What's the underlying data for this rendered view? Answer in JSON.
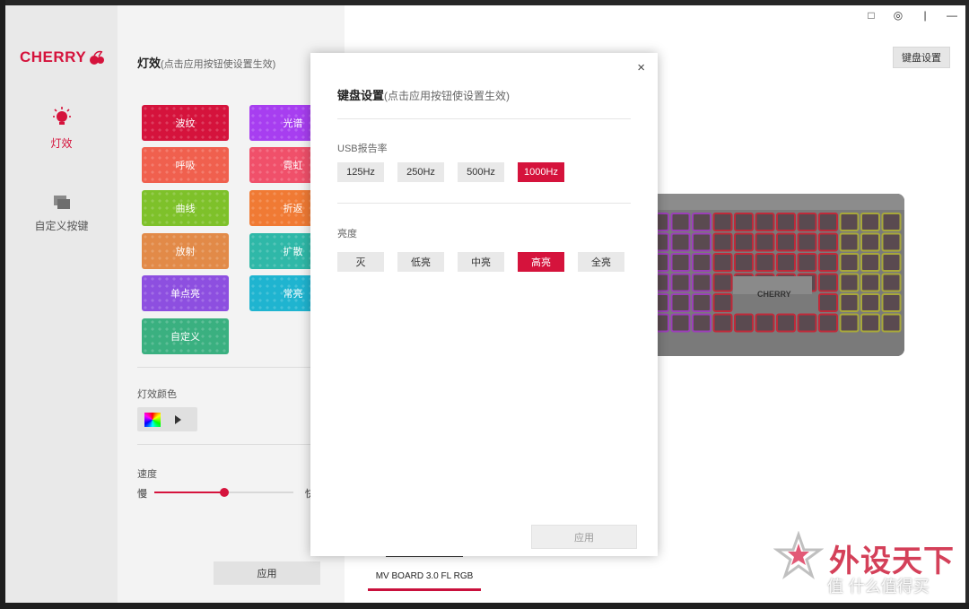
{
  "sidebar": {
    "logo_text": "CHERRY",
    "items": [
      {
        "label": "灯效",
        "icon": "bulb-icon",
        "active": true
      },
      {
        "label": "自定义按键",
        "icon": "keys-icon",
        "active": false
      }
    ]
  },
  "panel": {
    "title": "灯效",
    "title_hint": "(点击应用按钮使设置生效)",
    "effects": [
      {
        "label": "波纹",
        "color": "#d5133c"
      },
      {
        "label": "光谱",
        "color": "#a73ef0"
      },
      {
        "label": "呼吸",
        "color": "#f0604e"
      },
      {
        "label": "霓虹",
        "color": "#f0506a"
      },
      {
        "label": "曲线",
        "color": "#7ec12a"
      },
      {
        "label": "折返",
        "color": "#f07a34"
      },
      {
        "label": "放射",
        "color": "#e28a48"
      },
      {
        "label": "扩散",
        "color": "#2fb8a8"
      },
      {
        "label": "单点亮",
        "color": "#8d4fe0"
      },
      {
        "label": "常亮",
        "color": "#1fb4d0"
      },
      {
        "label": "自定义",
        "color": "#3ab080"
      }
    ],
    "color_label": "灯效颜色",
    "speed_label": "速度",
    "speed_slow": "慢",
    "speed_fast": "快",
    "speed_value": 0.5,
    "apply_label": "应用"
  },
  "main": {
    "keyboard_settings_button": "键盘设置",
    "device_name": "MV BOARD 3.0 FL RGB",
    "keyboard_brand": "CHERRY"
  },
  "window_controls": [
    "□",
    "◎",
    "|",
    "—"
  ],
  "modal": {
    "title": "键盘设置",
    "title_hint": "(点击应用按钮使设置生效)",
    "close_label": "×",
    "usb_label": "USB报告率",
    "usb_options": [
      {
        "label": "125Hz",
        "active": false
      },
      {
        "label": "250Hz",
        "active": false
      },
      {
        "label": "500Hz",
        "active": false
      },
      {
        "label": "1000Hz",
        "active": true
      }
    ],
    "brightness_label": "亮度",
    "brightness_options": [
      {
        "label": "灭",
        "active": false
      },
      {
        "label": "低亮",
        "active": false
      },
      {
        "label": "中亮",
        "active": false
      },
      {
        "label": "高亮",
        "active": true
      },
      {
        "label": "全亮",
        "active": false
      }
    ],
    "apply_label": "应用"
  },
  "watermark": {
    "main": "外设天下",
    "sub": "值 什么值得买"
  }
}
